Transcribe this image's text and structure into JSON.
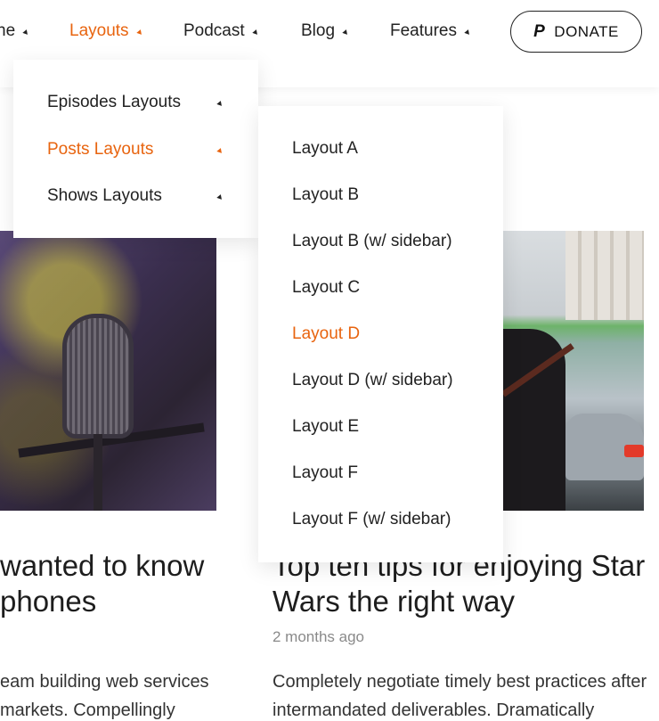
{
  "nav": {
    "items": [
      {
        "label": "ne",
        "active": false
      },
      {
        "label": "Layouts",
        "active": true
      },
      {
        "label": "Podcast",
        "active": false
      },
      {
        "label": "Blog",
        "active": false
      },
      {
        "label": "Features",
        "active": false
      }
    ],
    "donate_label": "DONATE",
    "donate_icon": "paypal-icon",
    "accent_color": "#e8640f"
  },
  "layouts_menu": {
    "items": [
      {
        "label": "Episodes Layouts",
        "active": false
      },
      {
        "label": "Posts Layouts",
        "active": true
      },
      {
        "label": "Shows Layouts",
        "active": false
      }
    ]
  },
  "posts_layouts_menu": {
    "items": [
      {
        "label": "Layout A",
        "active": false
      },
      {
        "label": "Layout B",
        "active": false
      },
      {
        "label": "Layout B (w/ sidebar)",
        "active": false
      },
      {
        "label": "Layout C",
        "active": false
      },
      {
        "label": "Layout D",
        "active": true
      },
      {
        "label": "Layout D (w/ sidebar)",
        "active": false
      },
      {
        "label": "Layout E",
        "active": false
      },
      {
        "label": "Layout F",
        "active": false
      },
      {
        "label": "Layout F (w/ sidebar)",
        "active": false
      }
    ]
  },
  "posts": [
    {
      "title_line1": "wanted to know",
      "title_line2": "phones",
      "excerpt_line1": "eam building web services",
      "excerpt_line2": "markets. Compellingly"
    },
    {
      "title_line1": "Top ten tips for enjoying Star",
      "title_line2": "Wars the right way",
      "date": "2 months ago",
      "excerpt_line1": "Completely negotiate timely best practices after",
      "excerpt_line2": "intermandated deliverables. Dramatically"
    }
  ]
}
